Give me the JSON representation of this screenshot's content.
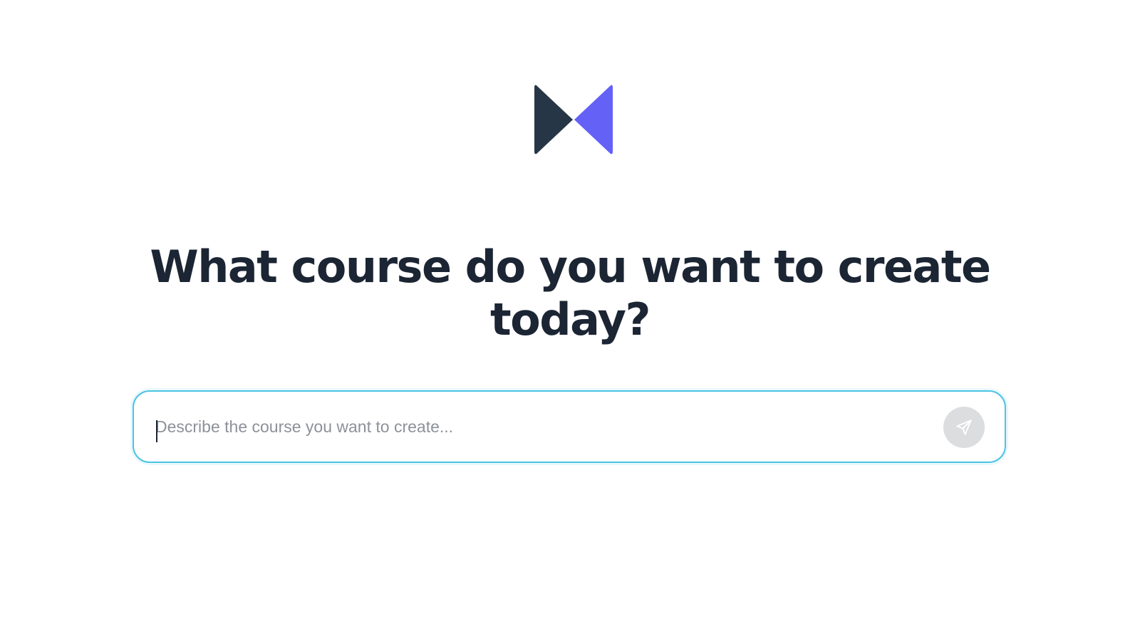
{
  "app": {
    "logo_icon": "m-logo-icon",
    "colors": {
      "logo_dark": "#273646",
      "logo_accent": "#6461f7",
      "heading": "#1b2533",
      "input_border": "#4cc3e3",
      "placeholder": "#8d9198",
      "send_button_bg": "#dcdddf"
    }
  },
  "hero": {
    "title": "What course do you want to create today?"
  },
  "prompt": {
    "value": "",
    "placeholder": "Describe the course you want to create...",
    "send_icon": "send-icon"
  }
}
